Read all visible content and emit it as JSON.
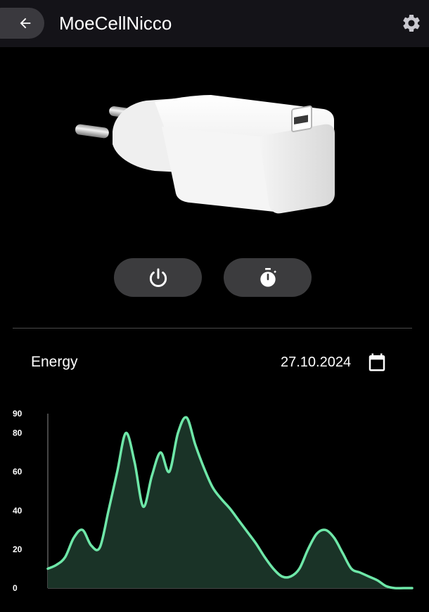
{
  "header": {
    "title": "MoeCellNicco",
    "back_icon": "arrow-left-icon",
    "settings_icon": "gear-icon"
  },
  "device": {
    "image": "usb-wall-charger"
  },
  "actions": {
    "power_icon": "power-icon",
    "timer_icon": "stopwatch-icon"
  },
  "energy": {
    "label": "Energy",
    "date": "27.10.2024",
    "calendar_icon": "calendar-icon"
  },
  "colors": {
    "accent_line": "#6ee7a8",
    "accent_fill": "#1a3327",
    "topbar_bg": "#141318",
    "button_bg": "#3c3c3e"
  },
  "chart_data": {
    "type": "area",
    "y_ticks": [
      "0",
      "20",
      "40",
      "60",
      "80",
      "90"
    ],
    "ylim": [
      0,
      90
    ],
    "x": [
      0,
      1,
      2,
      3,
      4,
      5,
      6,
      7,
      8,
      9,
      10,
      11,
      12,
      13,
      14,
      15,
      16,
      17,
      18,
      19,
      20,
      21,
      22,
      23,
      24,
      25,
      26,
      27,
      28,
      29,
      30,
      31,
      32,
      33,
      34,
      35,
      36,
      37,
      38,
      39,
      40,
      41,
      42
    ],
    "values": [
      10,
      12,
      16,
      26,
      30,
      22,
      21,
      40,
      60,
      80,
      65,
      42,
      58,
      70,
      60,
      80,
      88,
      74,
      62,
      52,
      46,
      41,
      35,
      29,
      23,
      16,
      10,
      6,
      6,
      10,
      20,
      28,
      30,
      26,
      18,
      10,
      8,
      6,
      4,
      1,
      0,
      0,
      0
    ],
    "xlabel": "",
    "ylabel": "",
    "grid": false
  }
}
